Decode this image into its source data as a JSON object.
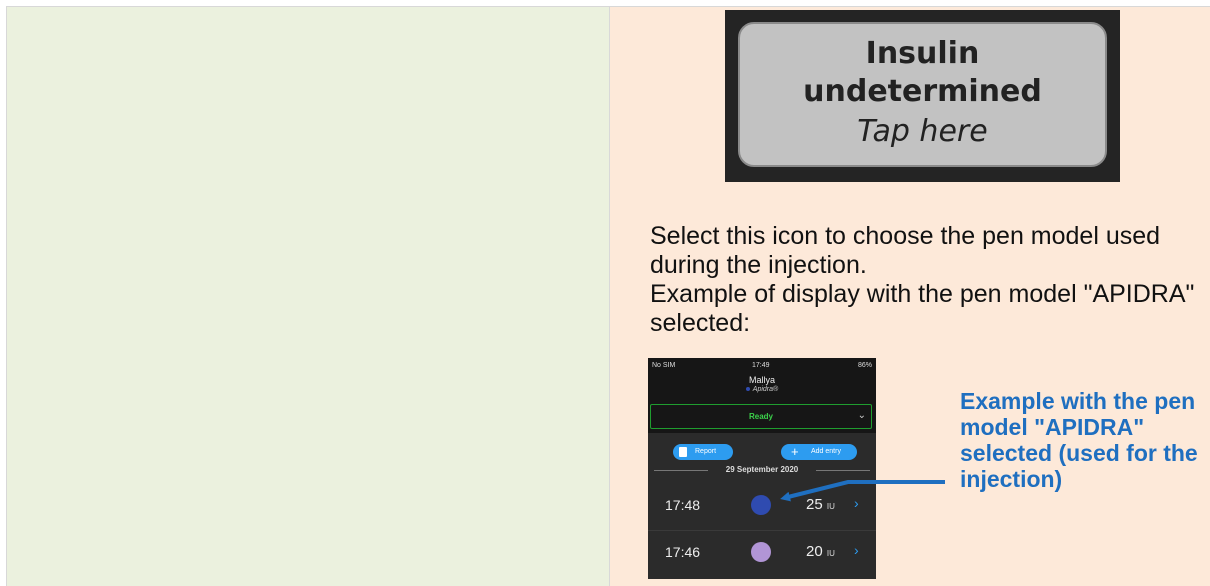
{
  "insulin_button": {
    "line1": "Insulin",
    "line2": "undetermined",
    "line3": "Tap here"
  },
  "description": {
    "paragraph1": "Select this icon to choose the pen model used during the injection.",
    "paragraph2": "Example of display with the pen model \"APIDRA\" selected:"
  },
  "phone": {
    "status": {
      "carrier": "No SIM",
      "time": "17:49",
      "battery": "86%"
    },
    "user_name": "Mallya",
    "pen_model": "Apidra®",
    "pen_color": "#2f4bb0",
    "status_label": "Ready",
    "report_label": "Report",
    "add_entry_label": "Add entry",
    "date": "29 September 2020",
    "entries": [
      {
        "time": "17:48",
        "dose": "25",
        "unit": "IU",
        "color": "#2f4bb0"
      },
      {
        "time": "17:46",
        "dose": "20",
        "unit": "IU",
        "color": "#b195d6"
      }
    ]
  },
  "callout": {
    "text": "Example with the pen model \"APIDRA\" selected (used for the injection)",
    "color": "#1f6fc0"
  }
}
